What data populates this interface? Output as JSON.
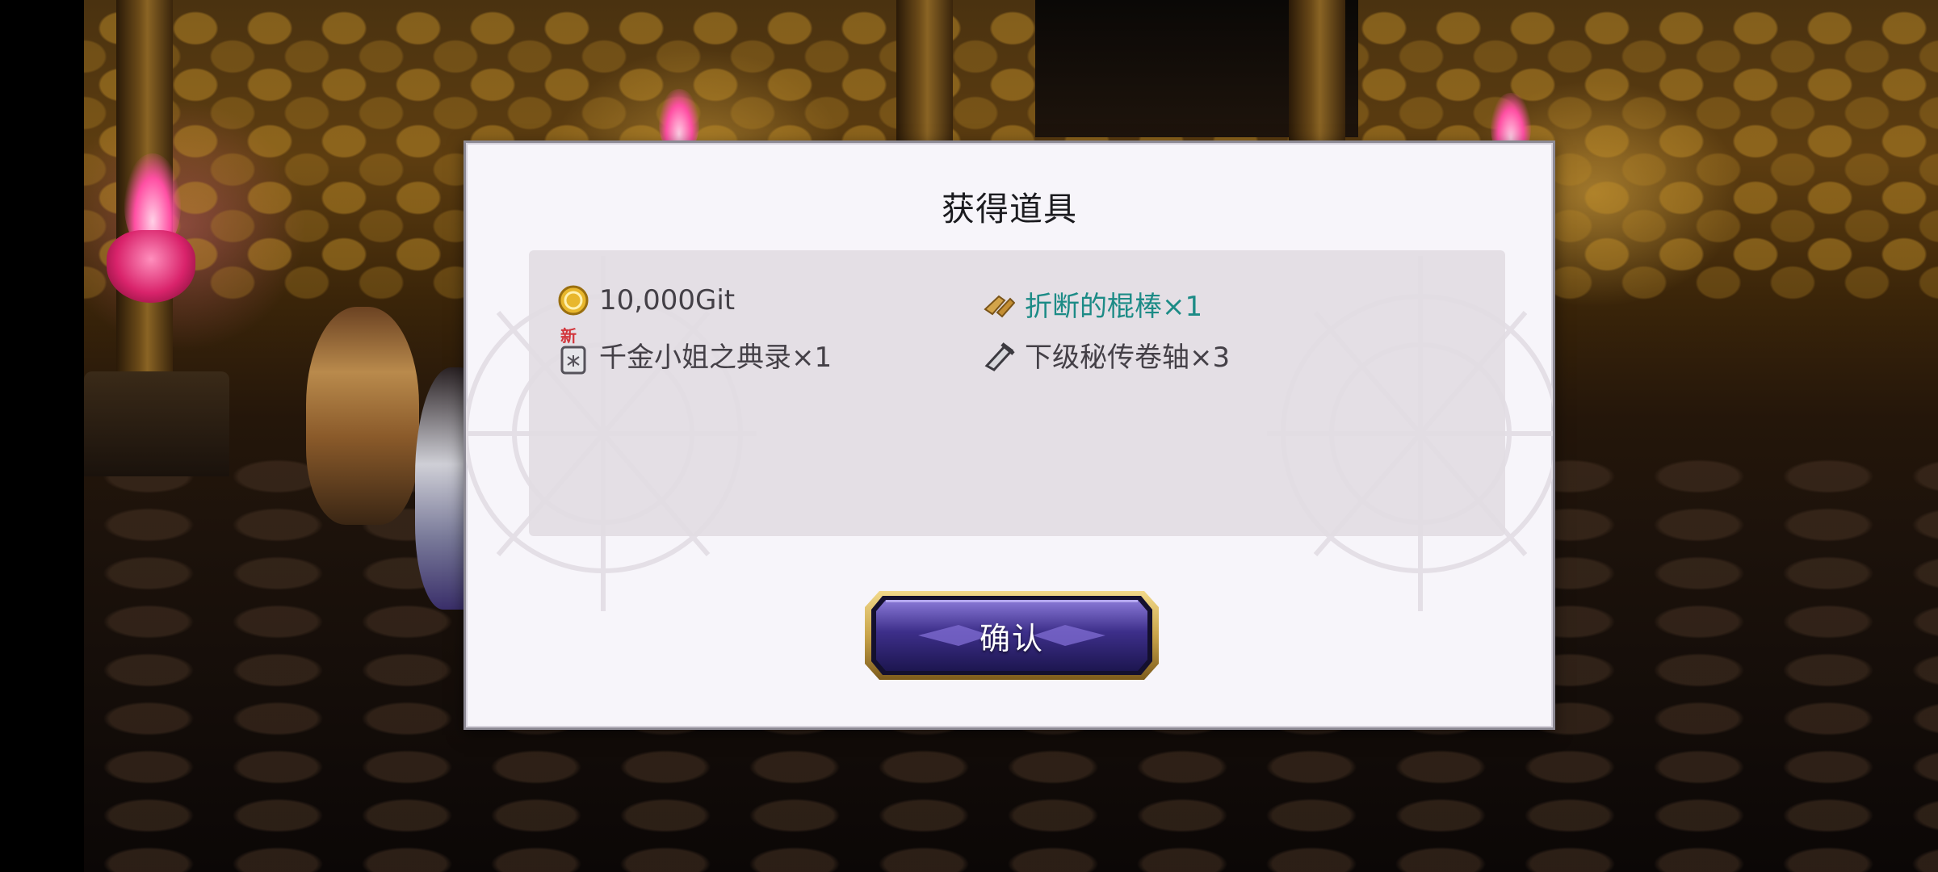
{
  "dialog": {
    "title": "获得道具",
    "confirm_label": "确认"
  },
  "items": [
    {
      "icon": "gold-coin-icon",
      "label": "10,000Git",
      "highlight": false
    },
    {
      "icon": "broken-stick-icon",
      "label": "折断的棍棒×1",
      "highlight": true
    },
    {
      "icon": "book-icon",
      "badge": "新",
      "label": "千金小姐之典录×1",
      "highlight": false
    },
    {
      "icon": "scroll-icon",
      "label": "下级秘传卷轴×3",
      "highlight": false
    }
  ],
  "colors": {
    "highlight_text": "#1c8b86",
    "normal_text": "#444047",
    "new_badge": "#d2353b",
    "button_gold_frame": "#c9a44a",
    "button_purple": "#3b2f86"
  }
}
